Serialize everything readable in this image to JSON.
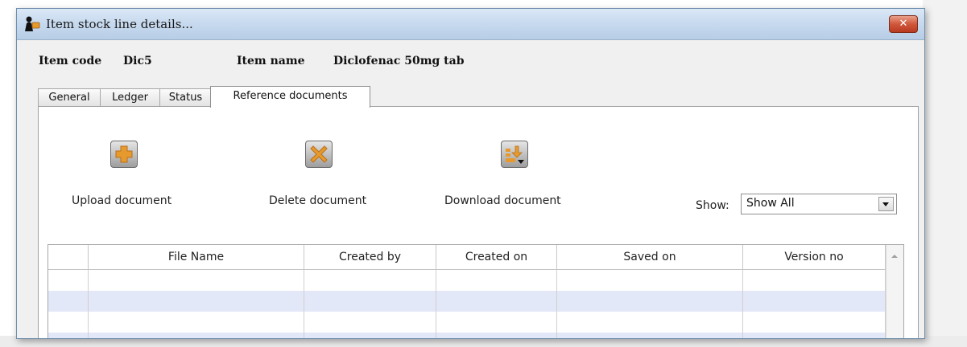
{
  "window": {
    "title": "Item stock line details...",
    "close_symbol": "✕",
    "icon": "app-figure-icon"
  },
  "item": {
    "code_label": "Item code",
    "code_value": "Dic5",
    "name_label": "Item name",
    "name_value": "Diclofenac 50mg tab"
  },
  "tabs": [
    {
      "label": "General",
      "active": false
    },
    {
      "label": "Ledger",
      "active": false
    },
    {
      "label": "Status",
      "active": false
    },
    {
      "label": "Reference documents",
      "active": true
    }
  ],
  "actions": {
    "upload": {
      "label": "Upload document",
      "icon": "plus-icon"
    },
    "delete": {
      "label": "Delete document",
      "icon": "x-icon"
    },
    "download": {
      "label": "Download document",
      "icon": "download-icon"
    }
  },
  "show_filter": {
    "label": "Show:",
    "value": "Show All"
  },
  "table": {
    "columns": [
      "",
      "File Name",
      "Created by",
      "Created on",
      "Saved on",
      "Version no"
    ],
    "rows": []
  },
  "colors": {
    "accent_orange": "#e69a2e",
    "row_alt": "#e3e8f9",
    "titlebar": "#c6d9ee"
  }
}
